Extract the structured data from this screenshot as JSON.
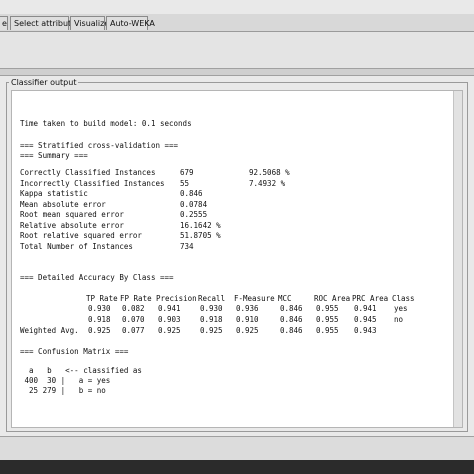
{
  "tabs": [
    "e",
    "Select attributes",
    "Visualize",
    "Auto-WEKA"
  ],
  "panel_title": "Classifier output",
  "output": {
    "build_time": "Time taken to build model: 0.1 seconds",
    "cv_header": "=== Stratified cross-validation ===",
    "summary_header": "=== Summary ===",
    "summary_rows": [
      {
        "label": "Correctly Classified Instances",
        "value": "679",
        "pct": "92.5068 %"
      },
      {
        "label": "Incorrectly Classified Instances",
        "value": "55",
        "pct": "7.4932 %"
      },
      {
        "label": "Kappa statistic",
        "value": "0.846",
        "pct": ""
      },
      {
        "label": "Mean absolute error",
        "value": "0.0784",
        "pct": ""
      },
      {
        "label": "Root mean squared error",
        "value": "0.2555",
        "pct": ""
      },
      {
        "label": "Relative absolute error",
        "value": "16.1642 %",
        "pct": ""
      },
      {
        "label": "Root relative squared error",
        "value": "51.8705 %",
        "pct": ""
      },
      {
        "label": "Total Number of Instances",
        "value": "734",
        "pct": ""
      }
    ],
    "accuracy_header": "=== Detailed Accuracy By Class ===",
    "accuracy_columns": [
      "TP Rate",
      "FP Rate",
      "Precision",
      "Recall",
      "F-Measure",
      "MCC",
      "ROC Area",
      "PRC Area",
      "Class"
    ],
    "accuracy_rows": [
      {
        "label": "",
        "cells": [
          "0.930",
          "0.082",
          "0.941",
          "0.930",
          "0.936",
          "0.846",
          "0.955",
          "0.941",
          "yes"
        ]
      },
      {
        "label": "",
        "cells": [
          "0.918",
          "0.070",
          "0.903",
          "0.918",
          "0.910",
          "0.846",
          "0.955",
          "0.945",
          "no"
        ]
      },
      {
        "label": "Weighted Avg.",
        "cells": [
          "0.925",
          "0.077",
          "0.925",
          "0.925",
          "0.925",
          "0.846",
          "0.955",
          "0.943",
          ""
        ]
      }
    ],
    "confusion_header": "=== Confusion Matrix ===",
    "confusion_lines": [
      "  a   b   <-- classified as",
      " 400  30 |   a = yes",
      "  25 279 |   b = no"
    ]
  }
}
